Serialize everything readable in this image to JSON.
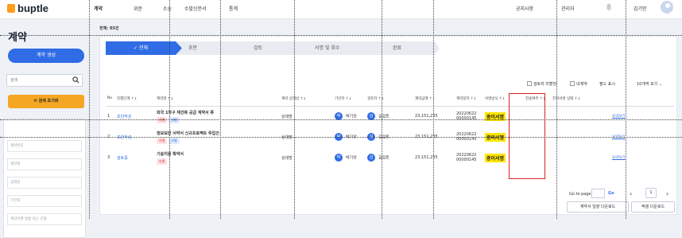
{
  "app": {
    "logo": "buptle"
  },
  "nav": [
    {
      "label": "계약",
      "active": true
    },
    {
      "label": "위문",
      "active": false
    },
    {
      "label": "소송",
      "active": false
    },
    {
      "label": "수발신문서",
      "active": false
    },
    {
      "label": "통계",
      "active": false
    }
  ],
  "topright": {
    "notice": "공지사항",
    "admin": "관리자",
    "user": "김기안"
  },
  "sidebar": {
    "title": "계약",
    "create": "계약 생성",
    "search_placeholder": "검색",
    "reset": "검색 초기화",
    "filters": [
      "계약번호",
      "계약명",
      "상대방",
      "기안자",
      "계약이행 방법 또는 유형"
    ]
  },
  "main": {
    "count": "전체: 03건",
    "steps": [
      "전체",
      "초안",
      "검토",
      "서명 및 회수",
      "완료"
    ],
    "options": {
      "review": "검토자 미할당",
      "mine": "내계약",
      "fields": "필드 표시",
      "per_page": "10개씩 보기"
    },
    "columns": [
      "No",
      "진행단계",
      "계약명",
      "계약 상대방",
      "기안자",
      "검토자",
      "계약금액",
      "계약일자",
      "서명방식",
      "전송여부",
      "전자서명 상태",
      ""
    ],
    "rows": [
      {
        "no": "1",
        "status": "초안작성",
        "title": "화국 1차구 재건축 공급 계약서 류",
        "chips": [
          {
            "t": "라벨",
            "c": "red"
          },
          {
            "t": "라벨",
            "c": "blue"
          }
        ],
        "party": "상대방",
        "drafter_initial": "박",
        "drafter": "박기안",
        "reviewer_initial": "김",
        "reviewer": "김검토",
        "amount": "23,151,235",
        "date1": "20220622",
        "date2": "00000145",
        "sign": "종이서명",
        "download": "요약보기"
      },
      {
        "no": "2",
        "status": "초안작성",
        "title": "정보보안 서약서 신규프로젝트 투입건",
        "chips": [
          {
            "t": "라벨",
            "c": "red"
          },
          {
            "t": "라벨",
            "c": "blue"
          }
        ],
        "party": "상대방",
        "drafter_initial": "박",
        "drafter": "박기안",
        "reviewer_initial": "김",
        "reviewer": "김검토",
        "amount": "23,151,235",
        "date1": "20220622",
        "date2": "00000145",
        "sign": "종이서명",
        "download": "요약보기"
      },
      {
        "no": "3",
        "status": "검토중",
        "title": "기술지원 확약서",
        "chips": [
          {
            "t": "라벨",
            "c": "red"
          }
        ],
        "party": "상대방",
        "drafter_initial": "박",
        "drafter": "박기안",
        "reviewer_initial": "김",
        "reviewer": "김검토",
        "amount": "23,151,235",
        "date1": "20220622",
        "date2": "00000145",
        "sign": "종이서명",
        "download": "요약보기"
      }
    ],
    "pager": {
      "goto": "Go to page",
      "go": "Go",
      "current": "1"
    },
    "buttons": {
      "bulk": "계약서 일괄 다운로드",
      "excel": "엑셀 다운로드"
    }
  },
  "colors": {
    "accent": "#2f6ce5",
    "orange": "#f5a623",
    "highlight": "#ffe600",
    "red_box": "#e02020"
  }
}
